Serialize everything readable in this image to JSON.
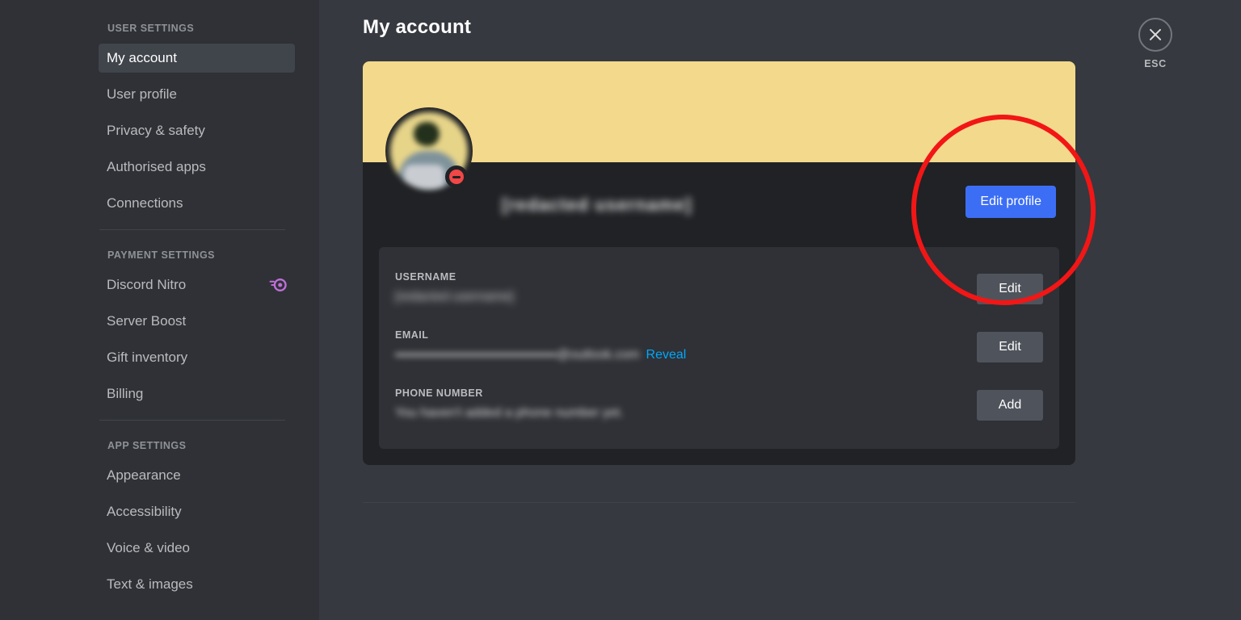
{
  "sidebar": {
    "groups": [
      {
        "header": "USER SETTINGS",
        "items": [
          {
            "label": "My account",
            "active": true
          },
          {
            "label": "User profile",
            "active": false
          },
          {
            "label": "Privacy & safety",
            "active": false
          },
          {
            "label": "Authorised apps",
            "active": false
          },
          {
            "label": "Connections",
            "active": false
          }
        ]
      },
      {
        "header": "PAYMENT SETTINGS",
        "items": [
          {
            "label": "Discord Nitro",
            "active": false,
            "icon": "nitro-icon"
          },
          {
            "label": "Server Boost",
            "active": false
          },
          {
            "label": "Gift inventory",
            "active": false
          },
          {
            "label": "Billing",
            "active": false
          }
        ]
      },
      {
        "header": "APP SETTINGS",
        "items": [
          {
            "label": "Appearance",
            "active": false
          },
          {
            "label": "Accessibility",
            "active": false
          },
          {
            "label": "Voice & video",
            "active": false
          },
          {
            "label": "Text & images",
            "active": false
          }
        ]
      }
    ]
  },
  "header": {
    "title": "My account",
    "close_label": "ESC",
    "close_icon": "close-icon"
  },
  "profile": {
    "banner_color": "#f3d98b",
    "avatar_status": "dnd",
    "display_name": "[redacted username]",
    "edit_profile_label": "Edit profile"
  },
  "fields": [
    {
      "label": "USERNAME",
      "value": "[redacted username]",
      "redacted": true,
      "action_label": "Edit",
      "action_name": "edit-username-button"
    },
    {
      "label": "EMAIL",
      "value": "@outlook.com",
      "redacted": true,
      "reveal_label": "Reveal",
      "action_label": "Edit",
      "action_name": "edit-email-button"
    },
    {
      "label": "PHONE NUMBER",
      "value": "You haven't added a phone number yet.",
      "redacted": true,
      "action_label": "Add",
      "action_name": "add-phone-button"
    }
  ],
  "colors": {
    "page_bg": "#36393f",
    "sidebar_bg": "#2f3136",
    "card_bg": "#202225",
    "panel_bg": "#2f3136",
    "accent_blue": "#3c6ef5",
    "link_blue": "#00a8fc",
    "gray_button": "#4f545c",
    "status_red": "#f04747",
    "annotation_red": "#f21616",
    "nitro_purple": "#c06fd8"
  }
}
